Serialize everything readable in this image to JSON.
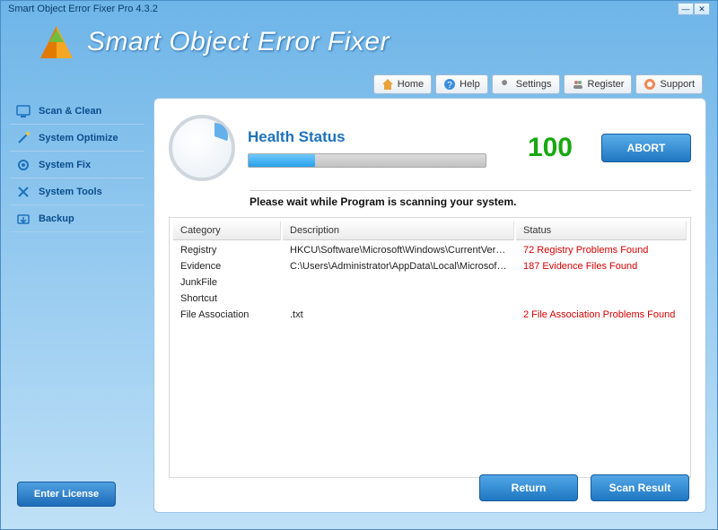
{
  "window": {
    "title": "Smart Object Error Fixer Pro 4.3.2"
  },
  "header": {
    "app_name": "Smart Object Error Fixer"
  },
  "toolbar": {
    "home": "Home",
    "help": "Help",
    "settings": "Settings",
    "register": "Register",
    "support": "Support"
  },
  "sidebar": {
    "items": [
      {
        "label": "Scan & Clean"
      },
      {
        "label": "System Optimize"
      },
      {
        "label": "System Fix"
      },
      {
        "label": "System Tools"
      },
      {
        "label": "Backup"
      }
    ],
    "enter_license": "Enter License"
  },
  "status": {
    "health_title": "Health Status",
    "score": "100",
    "abort": "ABORT",
    "message": "Please wait while  Program is scanning your system.",
    "progress_pct": 28
  },
  "table": {
    "headers": {
      "category": "Category",
      "description": "Description",
      "status": "Status"
    },
    "rows": [
      {
        "category": "Registry",
        "description": "HKCU\\Software\\Microsoft\\Windows\\CurrentVersion\\Explorer\\FileEx...",
        "status": "72 Registry Problems Found"
      },
      {
        "category": "Evidence",
        "description": "C:\\Users\\Administrator\\AppData\\Local\\Microsoft\\Windows\\Tempor...",
        "status": "187 Evidence Files Found"
      },
      {
        "category": "JunkFile",
        "description": "",
        "status": ""
      },
      {
        "category": "Shortcut",
        "description": "",
        "status": ""
      },
      {
        "category": "File Association",
        "description": ".txt",
        "status": "2 File Association Problems Found"
      }
    ]
  },
  "bottom": {
    "return": "Return",
    "scan_result": "Scan Result"
  }
}
